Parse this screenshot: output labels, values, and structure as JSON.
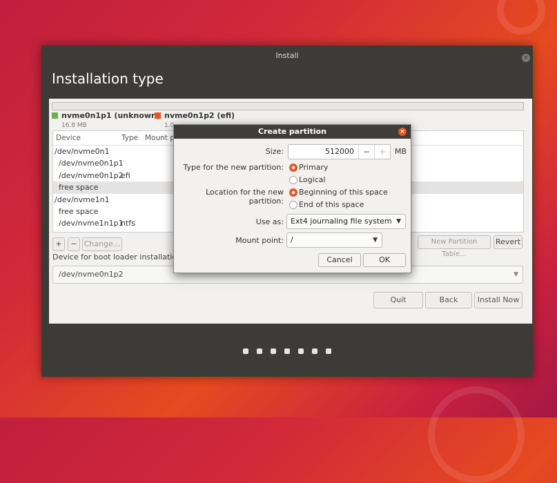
{
  "window": {
    "title": "Install",
    "close_glyph": "×"
  },
  "page_title": "Installation type",
  "legend": [
    {
      "name": "nvme0n1p1 (unknown)",
      "size": "16.8 MB",
      "color": "#6ab04c"
    },
    {
      "name": "nvme0n1p2 (efi)",
      "size": "1.0",
      "color": "#e95420"
    }
  ],
  "table": {
    "headers": [
      "Device",
      "Type",
      "Mount p"
    ],
    "rows": [
      {
        "device": "/dev/nvme0n1",
        "type": "",
        "indent": false,
        "selected": false
      },
      {
        "device": "/dev/nvme0n1p1",
        "type": "",
        "indent": true,
        "selected": false
      },
      {
        "device": "/dev/nvme0n1p2",
        "type": "efi",
        "indent": true,
        "selected": false
      },
      {
        "device": "free space",
        "type": "",
        "indent": true,
        "selected": true
      },
      {
        "device": "/dev/nvme1n1",
        "type": "",
        "indent": false,
        "selected": false
      },
      {
        "device": "free space",
        "type": "",
        "indent": true,
        "selected": false
      },
      {
        "device": "/dev/nvme1n1p1",
        "type": "ntfs",
        "indent": true,
        "selected": false
      }
    ]
  },
  "table_buttons": {
    "add": "+",
    "remove": "−",
    "change": "Change...",
    "new_table": "New Partition Table...",
    "revert": "Revert"
  },
  "boot_loader": {
    "label": "Device for boot loader installation",
    "value": "/dev/nvme0n1p2"
  },
  "nav": {
    "quit": "Quit",
    "back": "Back",
    "install_now": "Install Now"
  },
  "progress": {
    "step_count_shown": 7
  },
  "dialog": {
    "title": "Create partition",
    "close_glyph": "×",
    "size_label": "Size:",
    "size_value": "512000",
    "size_unit": "MB",
    "minus": "−",
    "plus": "+",
    "type_label": "Type for the new partition:",
    "type_options": [
      "Primary",
      "Logical"
    ],
    "type_selected": "Primary",
    "location_label": "Location for the new partition:",
    "location_options": [
      "Beginning of this space",
      "End of this space"
    ],
    "location_selected": "Beginning of this space",
    "use_as_label": "Use as:",
    "use_as_value": "Ext4 journaling file system",
    "mount_label": "Mount point:",
    "mount_value": "/",
    "cancel": "Cancel",
    "ok": "OK"
  },
  "colors": {
    "accent": "#e95420",
    "window_bg": "#3c3b37"
  }
}
